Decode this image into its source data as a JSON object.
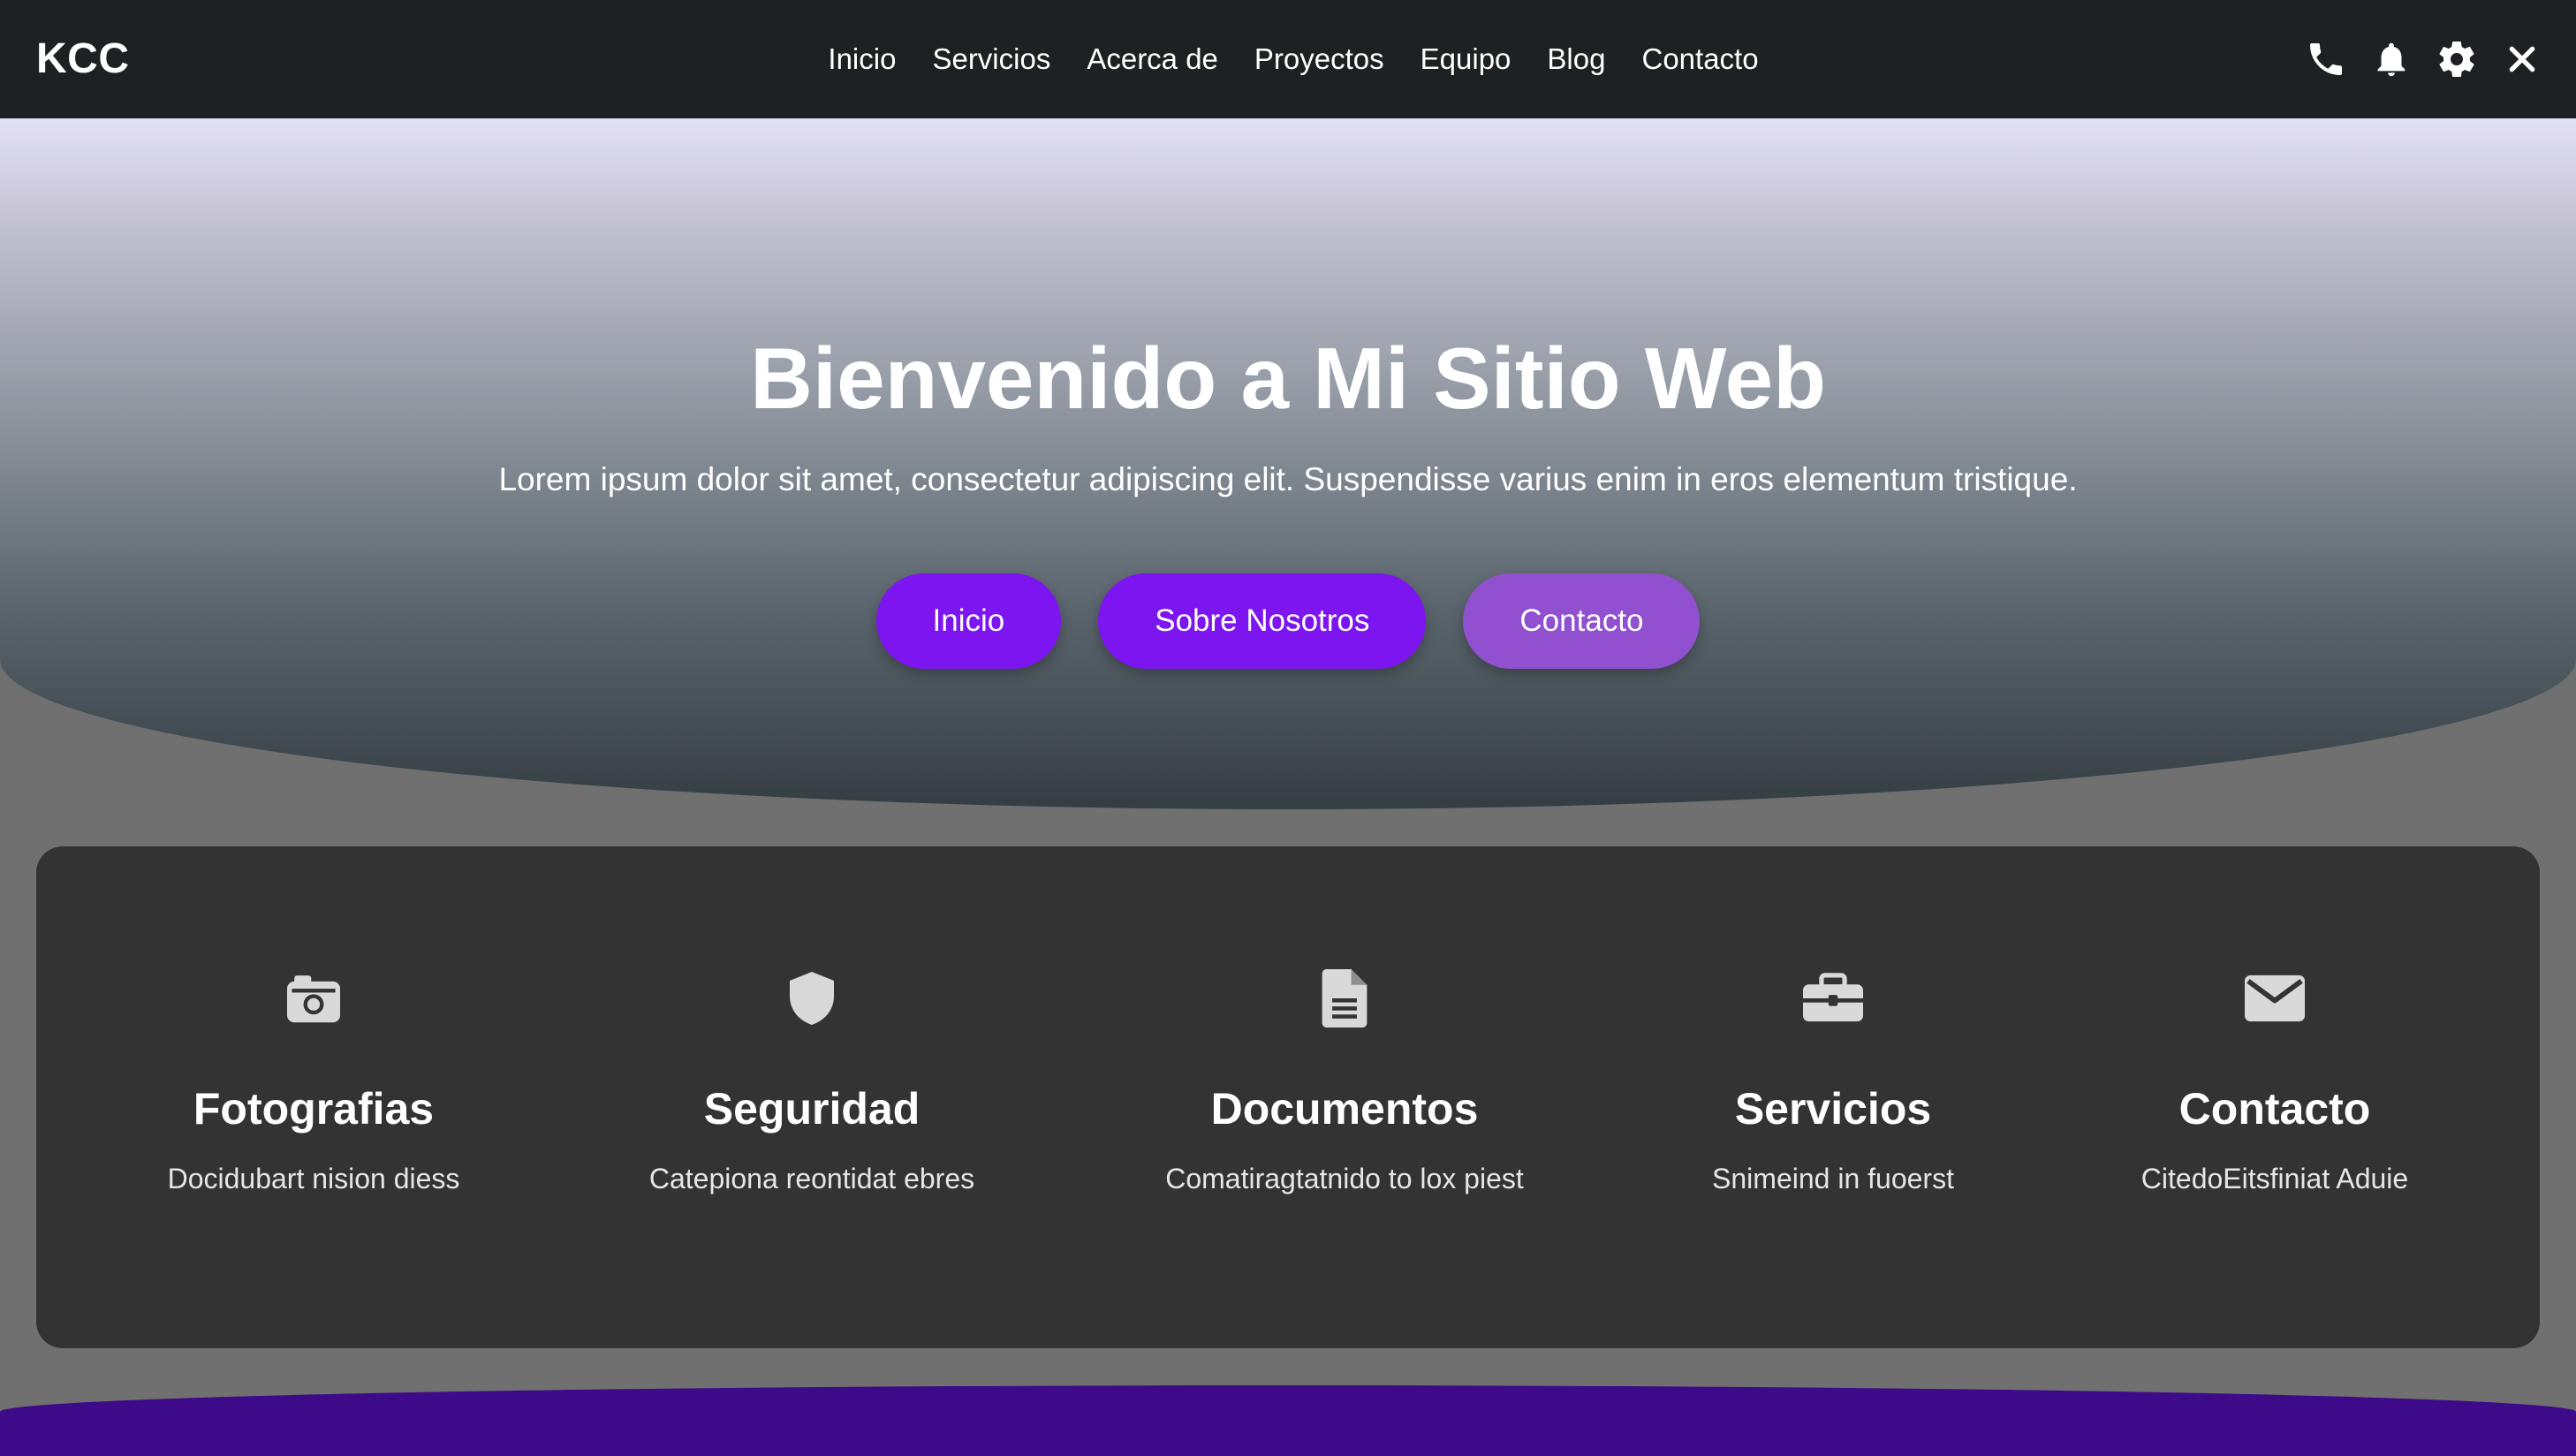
{
  "navbar": {
    "brand": "KCC",
    "links": [
      "Inicio",
      "Servicios",
      "Acerca de",
      "Proyectos",
      "Equipo",
      "Blog",
      "Contacto"
    ],
    "icons": [
      "phone-icon",
      "bell-icon",
      "gear-icon",
      "close-icon"
    ]
  },
  "hero": {
    "title": "Bienvenido a Mi Sitio Web",
    "subtitle": "Lorem ipsum dolor sit amet, consectetur adipiscing elit. Suspendisse varius enim in eros elementum tristique.",
    "buttons": [
      "Inicio",
      "Sobre Nosotros",
      "Contacto"
    ]
  },
  "features": [
    {
      "icon": "camera-icon",
      "title": "Fotografias",
      "desc": "Docidubart nision diess"
    },
    {
      "icon": "shield-icon",
      "title": "Seguridad",
      "desc": "Catepiona reontidat ebres"
    },
    {
      "icon": "document-icon",
      "title": "Documentos",
      "desc": "Comatiragtatnido to lox piest"
    },
    {
      "icon": "briefcase-icon",
      "title": "Servicios",
      "desc": "Snimeind in fuoerst"
    },
    {
      "icon": "envelope-icon",
      "title": "Contacto",
      "desc": "CitedoEitsfiniat Aduie"
    }
  ],
  "colors": {
    "navbar_bg": "#1e2023",
    "button_primary": "#7d15f0",
    "button_secondary": "#9050cf",
    "card_bg": "#333333",
    "icon_gray": "#d9d9d9"
  }
}
